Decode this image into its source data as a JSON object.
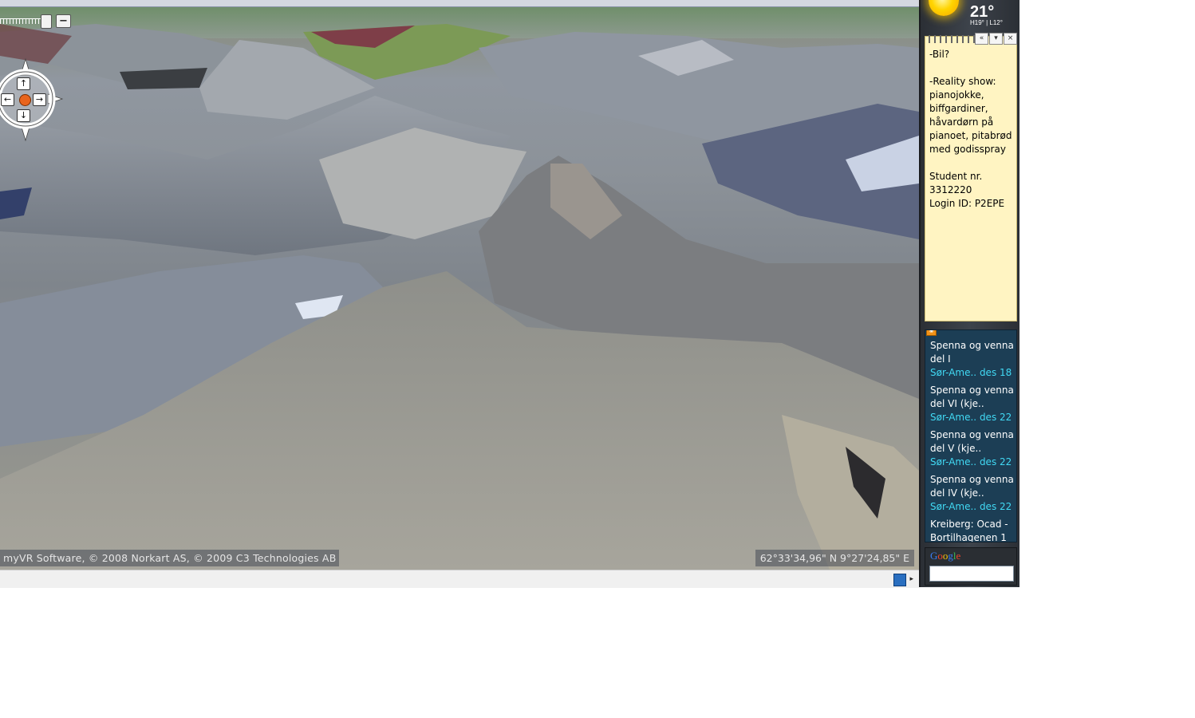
{
  "map": {
    "copyright": "myVR Software, © 2008 Norkart AS, © 2009 C3 Technologies AB",
    "coordinates": "62°33'34,96\" N  9°27'24,85\" E",
    "zoom_out_label": "−",
    "nav": {
      "up": "↑",
      "down": "↓",
      "left": "←",
      "right": "→"
    }
  },
  "sidebar": {
    "weather": {
      "temperature": "21°",
      "hilo": "H19° | L12°"
    },
    "note": {
      "controls": [
        "«",
        "▾",
        "×"
      ],
      "text": "-Bil?\n\n-Reality show: pianojokke, biffgardiner, håvardørn på pianoet, pitabrød med godisspray\n\nStudent nr. 3312220\nLogin ID: P2EPE"
    },
    "feed": {
      "items": [
        {
          "title": "Spenna og venna del I",
          "source": "Sør-Ame..",
          "date": "des 18"
        },
        {
          "title": "Spenna og venna del VI (kje..",
          "source": "Sør-Ame..",
          "date": "des 22"
        },
        {
          "title": "Spenna og venna del V (kje..",
          "source": "Sør-Ame..",
          "date": "des 22"
        },
        {
          "title": "Spenna og venna del IV (kje..",
          "source": "Sør-Ame..",
          "date": "des 22"
        },
        {
          "title": "Kreiberg: Ocad - Bortilhagenen 1",
          "source": "",
          "date": ""
        }
      ]
    },
    "search": {
      "logo": "Google",
      "value": ""
    }
  }
}
